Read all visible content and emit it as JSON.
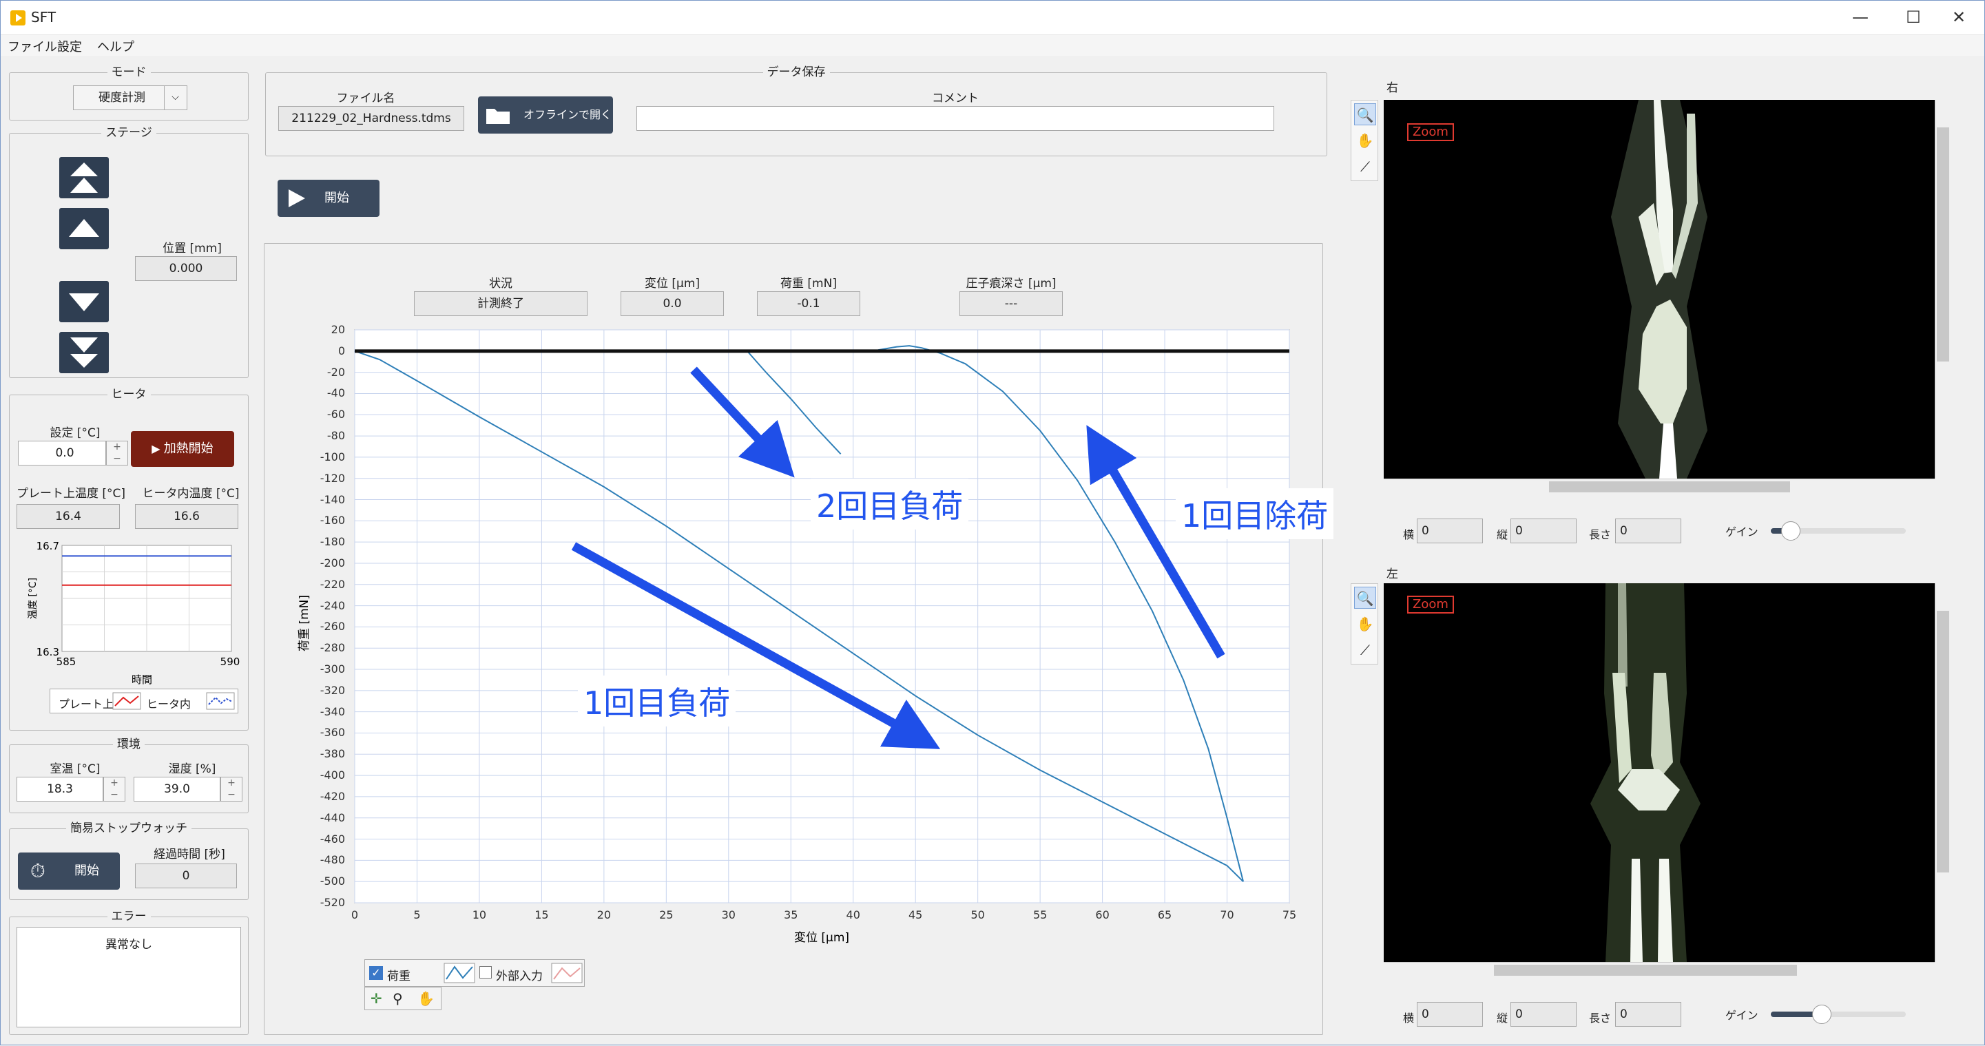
{
  "window": {
    "title": "SFT",
    "minimize": "—",
    "maximize": "☐",
    "close": "✕"
  },
  "menu": [
    "ファイル",
    "設定",
    "ヘルプ"
  ],
  "mode": {
    "title": "モード",
    "value": "硬度計測"
  },
  "stage": {
    "title": "ステージ",
    "position_label": "位置 [mm]",
    "position_value": "0.000"
  },
  "heater": {
    "title": "ヒータ",
    "setting_label": "設定 [°C]",
    "setting_value": "0.0",
    "start_button": "加熱開始",
    "plate_temp_label": "プレート上温度 [°C]",
    "plate_temp_value": "16.4",
    "heater_temp_label": "ヒータ内温度 [°C]",
    "heater_temp_value": "16.6",
    "mini_chart": {
      "ymax_label": "16.7",
      "ymin_label": "16.3",
      "xmin_label": "585",
      "xmax_label": "590",
      "xlabel": "時間",
      "ylabel": "温度 [°C]",
      "legend": [
        "プレート上",
        "ヒータ内"
      ],
      "plate_series": [
        16.66,
        16.66,
        16.66,
        16.66,
        16.66,
        16.66,
        16.66,
        16.66
      ],
      "heater_series": [
        16.55,
        16.55,
        16.55,
        16.55,
        16.55,
        16.55,
        16.55,
        16.55
      ]
    }
  },
  "environment": {
    "title": "環境",
    "room_temp_label": "室温 [°C]",
    "room_temp_value": "18.3",
    "humidity_label": "湿度 [%]",
    "humidity_value": "39.0"
  },
  "stopwatch": {
    "title": "簡易ストップウォッチ",
    "start_button": "開始",
    "elapsed_label": "経過時間 [秒]",
    "elapsed_value": "0"
  },
  "error": {
    "title": "エラー",
    "text": "異常なし"
  },
  "save": {
    "title": "データ保存",
    "file_label": "ファイル名",
    "file_value": "211229_02_Hardness.tdms",
    "open_button": "オフラインで開く",
    "comment_label": "コメント",
    "comment_value": ""
  },
  "start_button": "開始",
  "readouts": {
    "status_label": "状況",
    "status_value": "計測終了",
    "disp_label": "変位 [µm]",
    "disp_value": "0.0",
    "load_label": "荷重 [mN]",
    "load_value": "-0.1",
    "depth_label": "圧子痕深さ [µm]",
    "depth_value": "---"
  },
  "chart_data": {
    "type": "line",
    "xlabel": "変位 [µm]",
    "ylabel": "荷重 [mN]",
    "xlim": [
      0,
      75
    ],
    "ylim": [
      -520,
      20
    ],
    "xticks": [
      0,
      5,
      10,
      15,
      20,
      25,
      30,
      35,
      40,
      45,
      50,
      55,
      60,
      65,
      70,
      75
    ],
    "yticks": [
      20,
      0,
      -20,
      -40,
      -60,
      -80,
      -100,
      -120,
      -140,
      -160,
      -180,
      -200,
      -220,
      -240,
      -260,
      -280,
      -300,
      -320,
      -340,
      -360,
      -380,
      -400,
      -420,
      -440,
      -460,
      -480,
      -500,
      -520
    ],
    "grid": true,
    "legend": [
      "荷重",
      "外部入力"
    ],
    "legend_checked": [
      true,
      false
    ],
    "series": [
      {
        "name": "荷重",
        "color": "#2e7fb8",
        "x": [
          0,
          2,
          5,
          10,
          15,
          20,
          25,
          30,
          35,
          40,
          45,
          50,
          55,
          60,
          65,
          70,
          71.3
        ],
        "y": [
          0,
          -8,
          -28,
          -62,
          -95,
          -128,
          -165,
          -205,
          -245,
          -285,
          -325,
          -362,
          -395,
          -425,
          -455,
          -485,
          -500
        ]
      },
      {
        "name": "1回目除荷",
        "color": "#2e7fb8",
        "x": [
          71.3,
          70,
          68.5,
          66.5,
          64,
          61,
          58,
          55,
          52,
          49,
          47,
          45.5,
          44.5,
          43.5,
          42
        ],
        "y": [
          -500,
          -440,
          -375,
          -310,
          -245,
          -180,
          -122,
          -75,
          -38,
          -12,
          -2,
          3,
          5,
          4,
          1
        ]
      },
      {
        "name": "2回目負荷",
        "color": "#2e7fb8",
        "x": [
          0,
          10,
          20,
          30,
          31.5,
          33,
          35,
          37,
          39
        ],
        "y": [
          0,
          0,
          0,
          0,
          0,
          -20,
          -45,
          -72,
          -97
        ]
      },
      {
        "name": "zero",
        "color": "#111111",
        "x": [
          0,
          75
        ],
        "y": [
          0,
          0
        ]
      }
    ]
  },
  "annotations": {
    "load1": "1回目負荷",
    "load2": "2回目負荷",
    "unload1": "1回目除荷"
  },
  "camera_right": {
    "title": "右",
    "zoom_tag": "Zoom",
    "h_label": "横",
    "h_value": "0",
    "v_label": "縦",
    "v_value": "0",
    "len_label": "長さ",
    "len_value": "0",
    "gain_label": "ゲイン",
    "gain": 0.15
  },
  "camera_left": {
    "title": "左",
    "zoom_tag": "Zoom",
    "h_label": "横",
    "h_value": "0",
    "v_label": "縦",
    "v_value": "0",
    "len_label": "長さ",
    "len_value": "0",
    "gain_label": "ゲイン",
    "gain": 0.38
  }
}
